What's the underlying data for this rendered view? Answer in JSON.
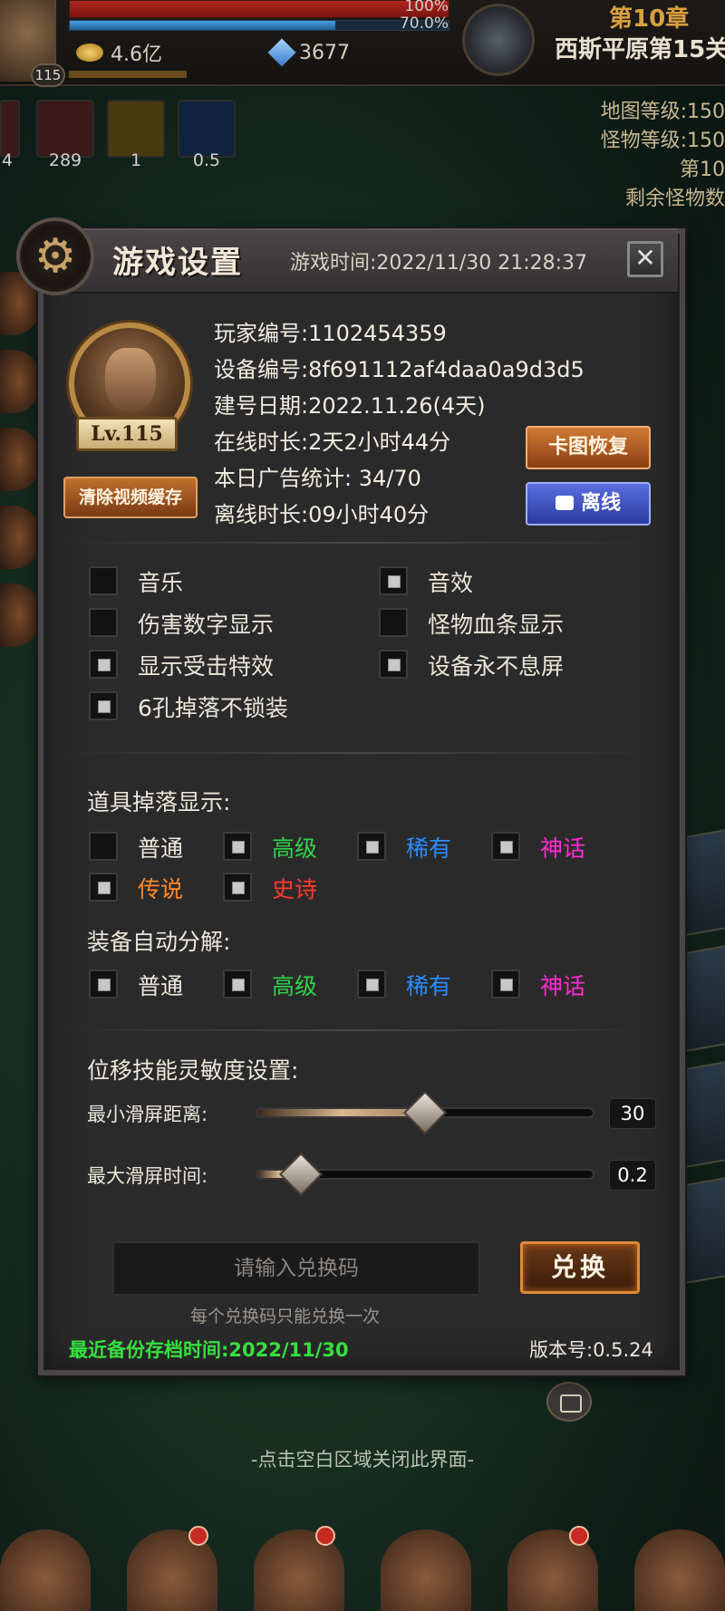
{
  "hud": {
    "player_level": "115",
    "hp_percent": "100%",
    "mp_percent": "70.0%",
    "gold": "4.6亿",
    "gems": "3677",
    "chapter": "第10章",
    "map_name": "西斯平原第15关",
    "side_info": [
      "地图等级:150",
      "怪物等级:150",
      "第10",
      "剩余怪物数"
    ],
    "buff_values": [
      "4",
      "289",
      "1",
      "0.5"
    ]
  },
  "dialog": {
    "title": "游戏设置",
    "game_time": "游戏时间:2022/11/30 21:28:37",
    "close_icon": "✕",
    "level_badge": "Lv.115",
    "info": {
      "player_id": "玩家编号:1102454359",
      "device_id": "设备编号:8f691112af4daa0a9d3d5",
      "created": "建号日期:2022.11.26(4天)",
      "online_time": "在线时长:2天2小时44分",
      "ad_stats": "本日广告统计:  34/70",
      "offline_time": "离线时长:09小时40分"
    },
    "buttons": {
      "clear_cache": "清除视频缓存",
      "restore": "卡图恢复",
      "offline": "离线"
    },
    "settings": [
      {
        "label": "音乐",
        "checked": false
      },
      {
        "label": "音效",
        "checked": true
      },
      {
        "label": "伤害数字显示",
        "checked": false
      },
      {
        "label": "怪物血条显示",
        "checked": false
      },
      {
        "label": "显示受击特效",
        "checked": true
      },
      {
        "label": "设备永不息屏",
        "checked": true
      },
      {
        "label": "6孔掉落不锁装",
        "checked": true
      }
    ],
    "drop_display": {
      "label": "道具掉落显示:",
      "items": [
        {
          "label": "普通",
          "checked": false
        },
        {
          "label": "高级",
          "checked": true
        },
        {
          "label": "稀有",
          "checked": true
        },
        {
          "label": "神话",
          "checked": true
        },
        {
          "label": "传说",
          "checked": true
        },
        {
          "label": "史诗",
          "checked": true
        }
      ]
    },
    "auto_decompose": {
      "label": "装备自动分解:",
      "items": [
        {
          "label": "普通",
          "checked": true
        },
        {
          "label": "高级",
          "checked": true
        },
        {
          "label": "稀有",
          "checked": true
        },
        {
          "label": "神话",
          "checked": true
        }
      ]
    },
    "sensitivity": {
      "label": "位移技能灵敏度设置:",
      "min_distance": {
        "label": "最小滑屏距离:",
        "value": "30",
        "fraction": 0.5
      },
      "max_time": {
        "label": "最大滑屏时间:",
        "value": "0.2",
        "fraction": 0.13
      }
    },
    "redeem": {
      "placeholder": "请输入兑换码",
      "button": "兑换",
      "note": "每个兑换码只能兑换一次"
    },
    "backup_time": "最近备份存档时间:2022/11/30",
    "version": "版本号:0.5.24"
  },
  "close_hint": "-点击空白区域关闭此界面-"
}
